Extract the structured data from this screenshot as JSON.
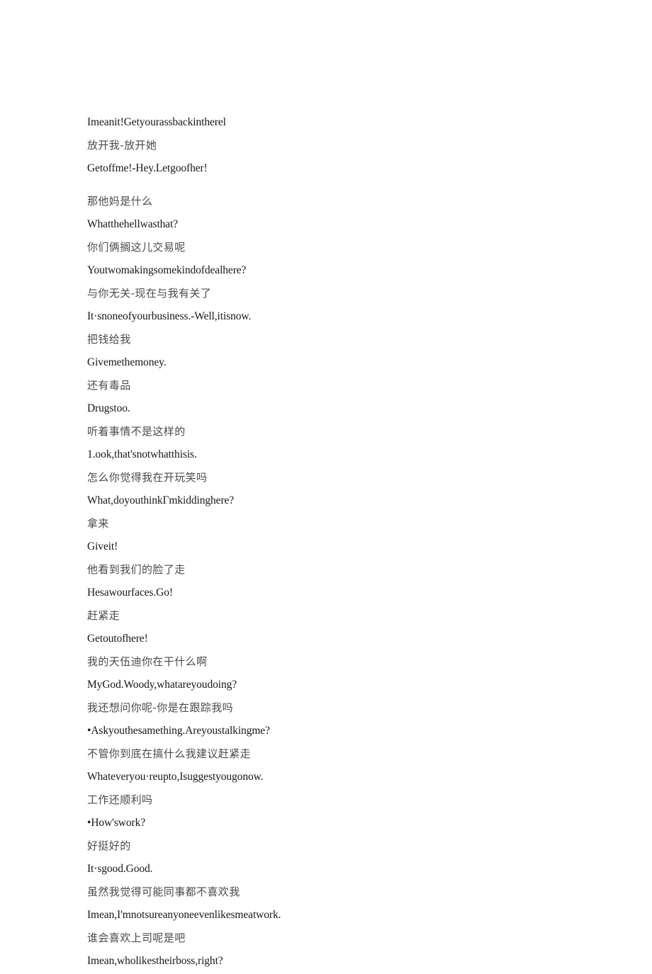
{
  "document": {
    "background_color": "#ffffff",
    "english_text_color": "#171717",
    "chinese_text_color": "#4a4a4a",
    "lines": [
      {
        "id": "l01",
        "lang": "en",
        "text": "Imeanit!Getyourassbackintherel",
        "gap_before": false
      },
      {
        "id": "l02",
        "lang": "zh",
        "text": "放开我-放开她",
        "gap_before": false
      },
      {
        "id": "l03",
        "lang": "en",
        "text": "Getoffme!-Hey.Letgoofher!",
        "gap_before": false
      },
      {
        "id": "l04",
        "lang": "zh",
        "text": "那他妈是什么",
        "gap_before": true
      },
      {
        "id": "l05",
        "lang": "en",
        "text": "Whatthehellwasthat?",
        "gap_before": false
      },
      {
        "id": "l06",
        "lang": "zh",
        "text": "你们俩搁这儿交易呢",
        "gap_before": false
      },
      {
        "id": "l07",
        "lang": "en",
        "text": "Youtwomakingsomekindofdealhere?",
        "gap_before": false
      },
      {
        "id": "l08",
        "lang": "zh",
        "text": "与你无关-现在与我有关了",
        "gap_before": false
      },
      {
        "id": "l09",
        "lang": "en",
        "text": "It·snoneofyourbusiness.-Well,itisnow.",
        "gap_before": false
      },
      {
        "id": "l10",
        "lang": "zh",
        "text": "把钱给我",
        "gap_before": false
      },
      {
        "id": "l11",
        "lang": "en",
        "text": "Givemethemoney.",
        "gap_before": false
      },
      {
        "id": "l12",
        "lang": "zh",
        "text": "还有毒品",
        "gap_before": false
      },
      {
        "id": "l13",
        "lang": "en",
        "text": "Drugstoo.",
        "gap_before": false
      },
      {
        "id": "l14",
        "lang": "zh",
        "text": "听着事情不是这样的",
        "gap_before": false
      },
      {
        "id": "l15",
        "lang": "en",
        "text": "1.ook,that'snotwhatthisis.",
        "gap_before": false
      },
      {
        "id": "l16",
        "lang": "zh",
        "text": "怎么你觉得我在开玩笑吗",
        "gap_before": false
      },
      {
        "id": "l17",
        "lang": "en",
        "text": "What,doyouthinkΓmkiddinghere?",
        "gap_before": false
      },
      {
        "id": "l18",
        "lang": "zh",
        "text": "拿来",
        "gap_before": false
      },
      {
        "id": "l19",
        "lang": "en",
        "text": "Giveit!",
        "gap_before": false
      },
      {
        "id": "l20",
        "lang": "zh",
        "text": "他看到我们的脸了走",
        "gap_before": false
      },
      {
        "id": "l21",
        "lang": "en",
        "text": "Hesawourfaces.Go!",
        "gap_before": false
      },
      {
        "id": "l22",
        "lang": "zh",
        "text": "赶紧走",
        "gap_before": false
      },
      {
        "id": "l23",
        "lang": "en",
        "text": "Getoutofhere!",
        "gap_before": false
      },
      {
        "id": "l24",
        "lang": "zh",
        "text": "我的天伍迪你在干什么啊",
        "gap_before": false
      },
      {
        "id": "l25",
        "lang": "en",
        "text": "MyGod.Woody,whatareyoudoing?",
        "gap_before": false
      },
      {
        "id": "l26",
        "lang": "zh",
        "text": "我还想问你呢-你是在跟踪我吗",
        "gap_before": false
      },
      {
        "id": "l27",
        "lang": "en",
        "text": "•Askyouthesamething.Areyoustalkingme?",
        "gap_before": false
      },
      {
        "id": "l28",
        "lang": "zh",
        "text": "不管你到底在搞什么我建议赶紧走",
        "gap_before": false
      },
      {
        "id": "l29",
        "lang": "en",
        "text": "Whateveryou·reupto,Isuggestyougonow.",
        "gap_before": false
      },
      {
        "id": "l30",
        "lang": "zh",
        "text": "工作还顺利吗",
        "gap_before": false
      },
      {
        "id": "l31",
        "lang": "en",
        "text": "•How'swork?",
        "gap_before": false
      },
      {
        "id": "l32",
        "lang": "zh",
        "text": "好挺好的",
        "gap_before": false
      },
      {
        "id": "l33",
        "lang": "en",
        "text": "It·sgood.Good.",
        "gap_before": false
      },
      {
        "id": "l34",
        "lang": "zh",
        "text": "虽然我觉得可能同事都不喜欢我",
        "gap_before": false
      },
      {
        "id": "l35",
        "lang": "en",
        "text": "Imean,I'mnotsureanyoneevenlikesmeatwork.",
        "gap_before": false
      },
      {
        "id": "l36",
        "lang": "zh",
        "text": "谁会喜欢上司呢是吧",
        "gap_before": false
      },
      {
        "id": "l37",
        "lang": "en",
        "text": "Imean,wholikestheirboss,right?",
        "gap_before": false
      }
    ]
  }
}
